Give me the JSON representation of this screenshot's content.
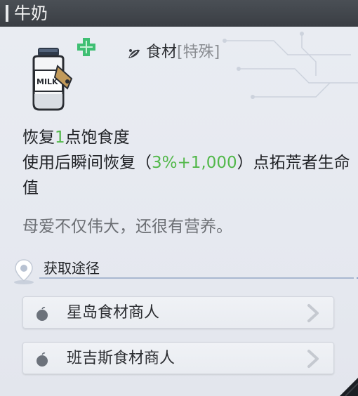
{
  "header": {
    "title": "牛奶"
  },
  "item": {
    "icon": "milk-bottle-icon",
    "heal_icon": "green-cross-heal-icon",
    "category": {
      "icon": "food-category-icon",
      "name": "食材",
      "sub": "[特殊]"
    }
  },
  "description": {
    "line1_pre": "恢复",
    "line1_value": "1",
    "line1_post": "点饱食度",
    "line2_pre": "使用后瞬间恢复（",
    "line2_value": "3%+1,000",
    "line2_post": "）点拓荒者生命值"
  },
  "flavor_text": "母爱不仅伟大，还很有营养。",
  "sources": {
    "title": "获取途径",
    "icon": "location-pin-icon",
    "items": [
      {
        "label": "星岛食材商人",
        "icon": "apple-icon"
      },
      {
        "label": "班吉斯食材商人",
        "icon": "apple-icon"
      }
    ]
  },
  "colors": {
    "highlight": "#52b84a",
    "header_bg": "#3e4248",
    "panel_bg": "#e8ebf1"
  }
}
